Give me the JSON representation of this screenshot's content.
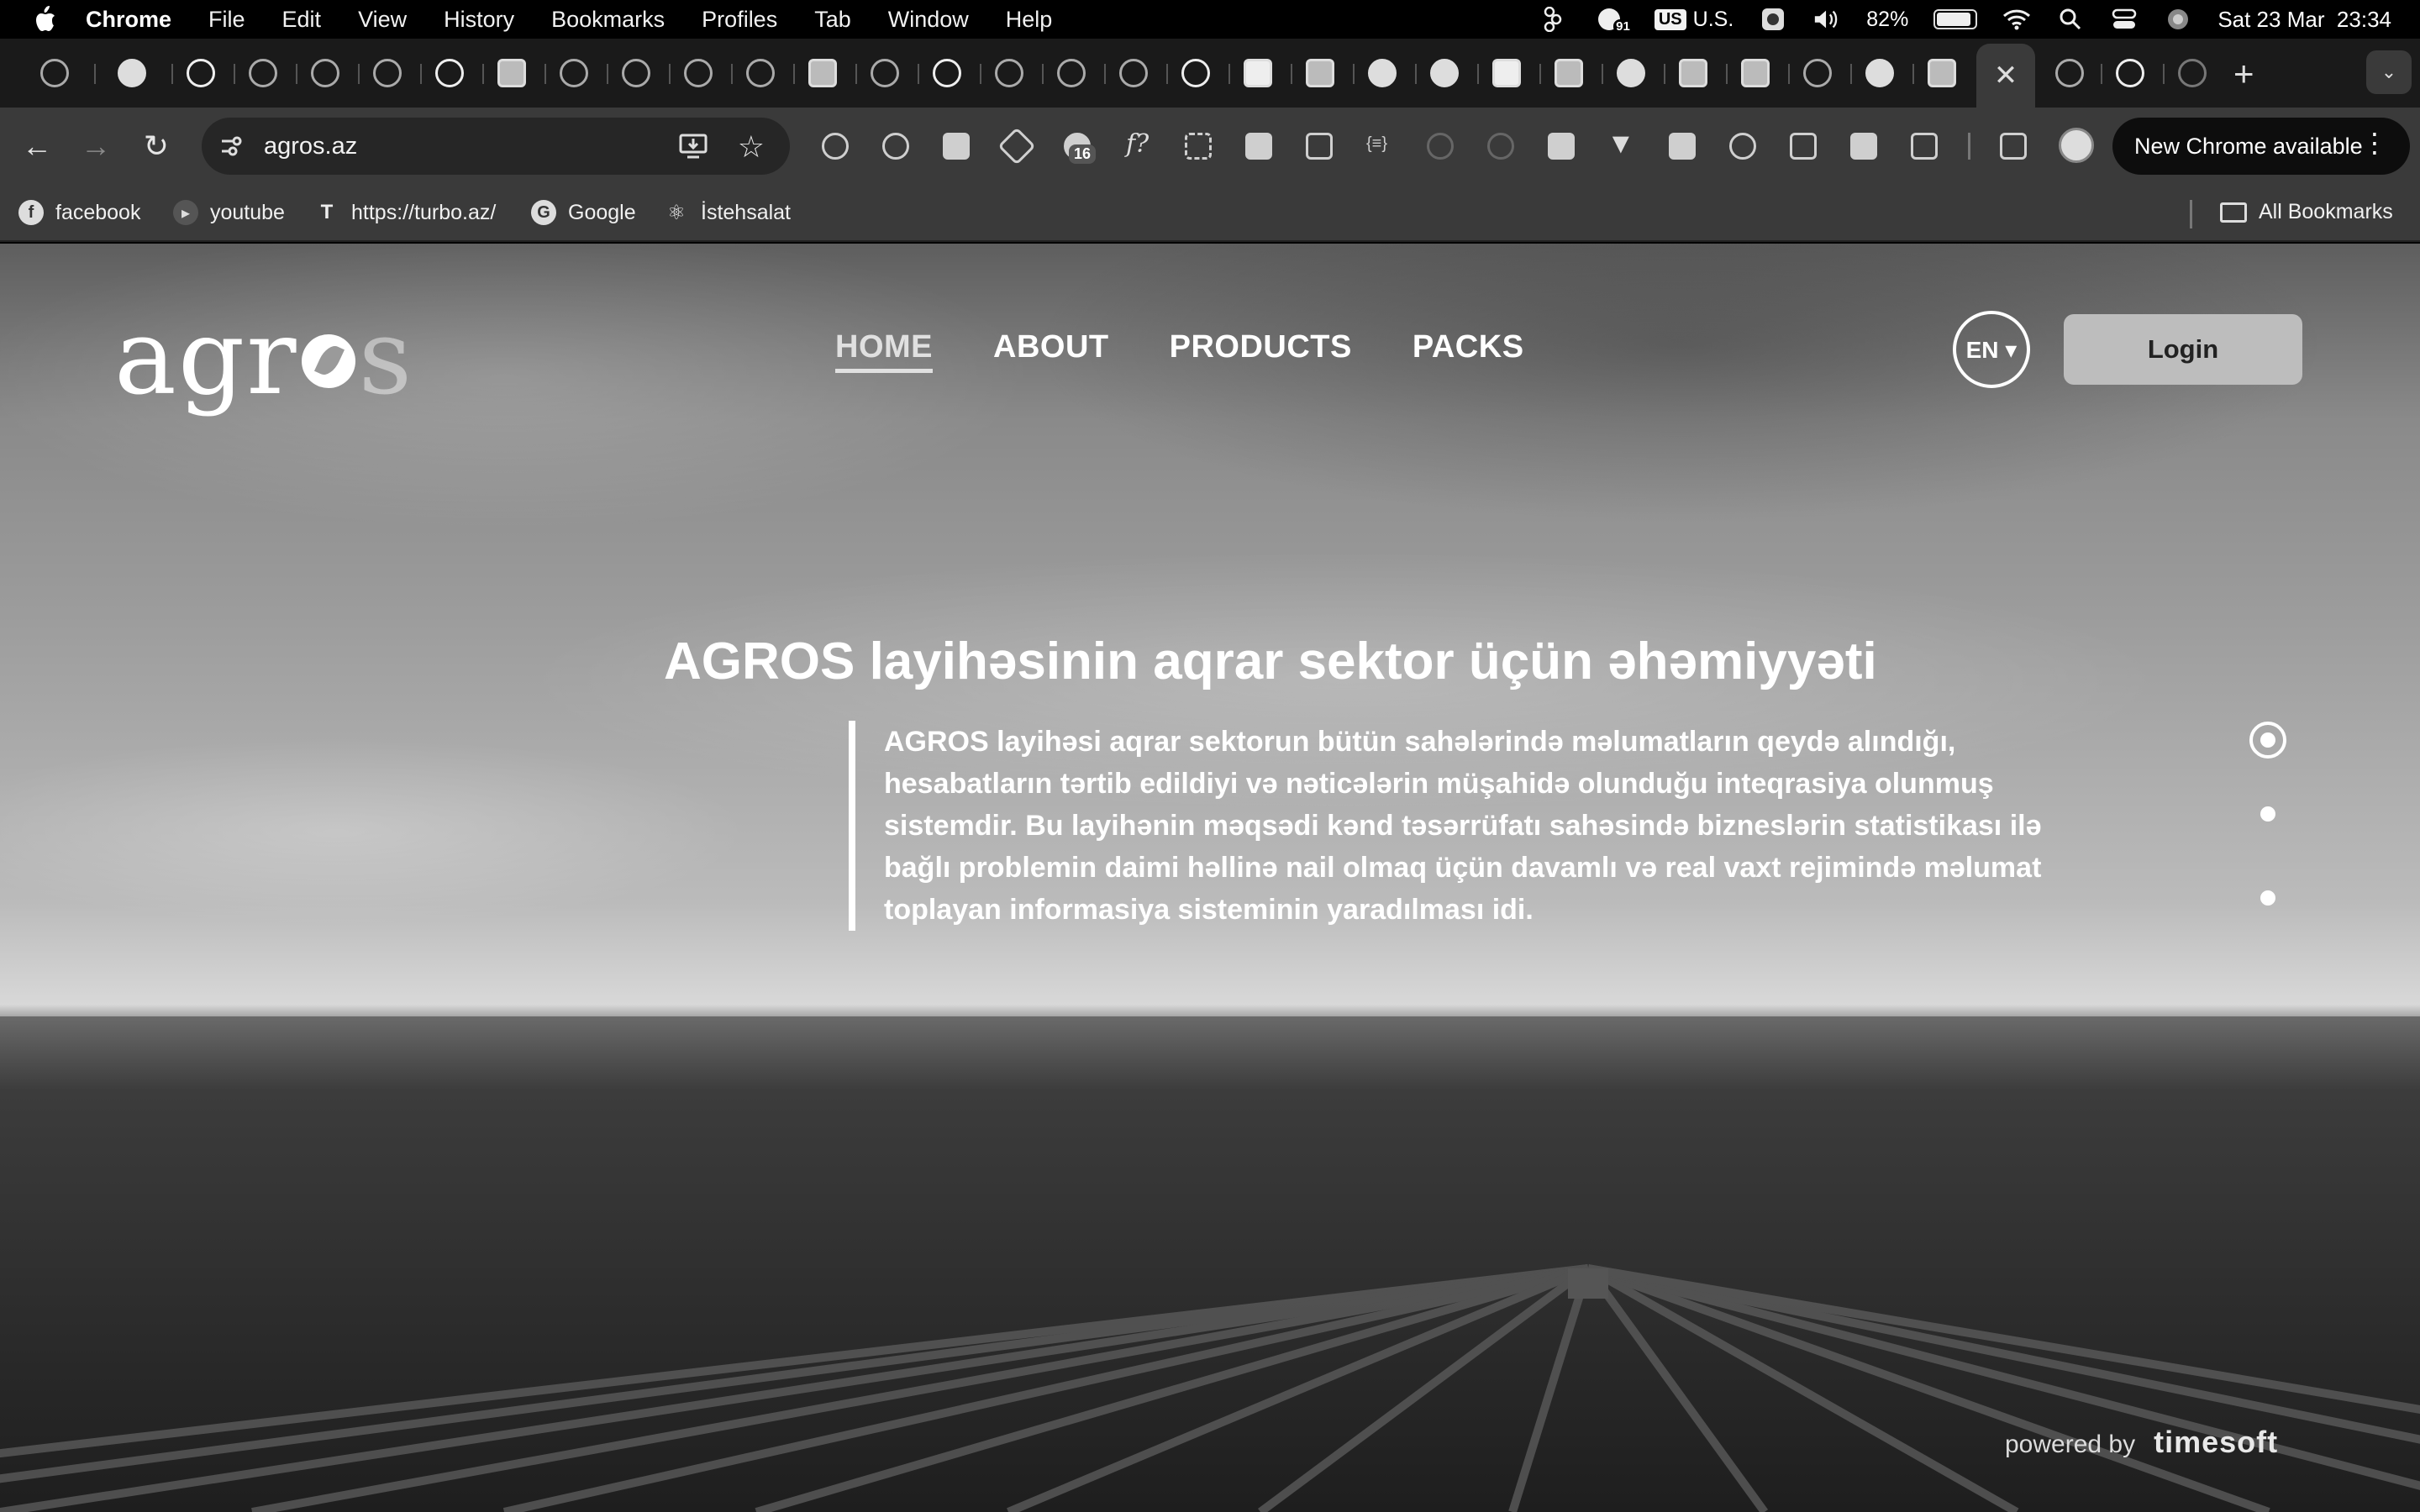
{
  "menubar": {
    "app": "Chrome",
    "items": [
      "File",
      "Edit",
      "View",
      "History",
      "Bookmarks",
      "Profiles",
      "Tab",
      "Window",
      "Help"
    ],
    "notification_count": "91",
    "input_source": "U.S.",
    "battery_percent": "82%",
    "battery_level": 0.82,
    "datetime": "Sat 23 Mar  23:34"
  },
  "toolbar": {
    "url": "agros.az",
    "extension_badge": "16",
    "update_label": "New Chrome available"
  },
  "bookmarks": {
    "items": [
      {
        "label": "facebook",
        "icon": "f"
      },
      {
        "label": "youtube",
        "icon": "▸"
      },
      {
        "label": "https://turbo.az/",
        "icon": "T"
      },
      {
        "label": "Google",
        "icon": "G"
      },
      {
        "label": "İstehsalat",
        "icon": "⚛"
      }
    ],
    "all_bookmarks": "All Bookmarks"
  },
  "site": {
    "logo": {
      "part1": "agr",
      "part2": "s"
    },
    "nav": [
      "HOME",
      "ABOUT",
      "PRODUCTS",
      "PACKS"
    ],
    "active_nav": "HOME",
    "lang": "EN ▾",
    "login": "Login",
    "hero": {
      "title": "AGROS layihəsinin aqrar sektor üçün əhəmiyyəti",
      "text": "AGROS layihəsi aqrar sektorun bütün sahələrində məlumatların qeydə alındığı, hesabatların tərtib edildiyi və nəticələrin müşahidə olunduğu inteqrasiya olunmuş sistemdir. Bu layihənin məqsədi kənd təsərrüfatı sahəsində bizneslərin statistikası ilə bağlı problemin daimi həllinə nail olmaq üçün davamlı və real vaxt rejimində məlumat toplayan informasiya sisteminin yaradılması idi."
    },
    "slider": {
      "count": 3,
      "active_index": 1
    },
    "footer": {
      "powered_by": "powered by",
      "brand": "timesoft"
    }
  }
}
